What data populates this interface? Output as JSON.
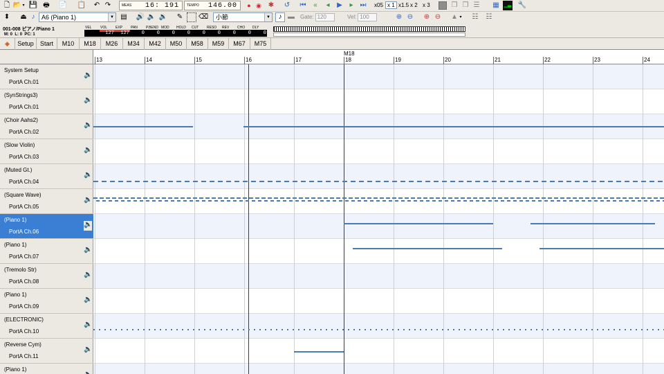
{
  "toolbar": {
    "meas_label": "MEAS",
    "meas_value": "16: 191",
    "tempo_label": "TEMPO",
    "tempo_value": "146.00",
    "speed": [
      "x05",
      "x 1",
      "x1.5",
      "x 2",
      "x 3"
    ]
  },
  "toolbar2": {
    "track_select": "A6 (Piano 1)",
    "unit_select": "小節",
    "gate_label": "Gate:",
    "gate_value": "120",
    "vel_label": "Vel:",
    "vel_value": "100"
  },
  "track_info": {
    "name": "001-008 ピアノ/Piano 1",
    "m_label": "M:",
    "m_value": "0",
    "l_label": "L:",
    "l_value": "0",
    "pc_label": "PC:",
    "pc_value": "1",
    "controls": [
      {
        "label": "VEL",
        "value": ""
      },
      {
        "label": "VOL",
        "value": "127"
      },
      {
        "label": "EXP",
        "value": "127"
      },
      {
        "label": "PAN",
        "value": "0"
      },
      {
        "label": "P.BEND",
        "value": "0"
      },
      {
        "label": "MOD",
        "value": "0"
      },
      {
        "label": "HOLD",
        "value": "0"
      },
      {
        "label": "CUT",
        "value": "0"
      },
      {
        "label": "RESO",
        "value": "0"
      },
      {
        "label": "REV",
        "value": "0"
      },
      {
        "label": "CHO",
        "value": "0"
      },
      {
        "label": "DLY",
        "value": "0"
      }
    ]
  },
  "markers": [
    "Setup",
    "Start",
    "M10",
    "M18",
    "M26",
    "M34",
    "M42",
    "M50",
    "M58",
    "M59",
    "M67",
    "M75"
  ],
  "ruler": {
    "measures": [
      "13",
      "14",
      "15",
      "16",
      "17",
      "18",
      "19",
      "20",
      "21",
      "22",
      "23",
      "24"
    ],
    "marker_label": "M18"
  },
  "tracks": [
    {
      "name": "System Setup",
      "port": "PortA  Ch.01",
      "selected": false
    },
    {
      "name": "(SynStrings3)",
      "port": "PortA  Ch.01",
      "selected": false
    },
    {
      "name": "(Choir Aahs2)",
      "port": "PortA  Ch.02",
      "selected": false
    },
    {
      "name": "(Slow Violin)",
      "port": "PortA  Ch.03",
      "selected": false
    },
    {
      "name": "(Muted Gt.)",
      "port": "PortA  Ch.04",
      "selected": false
    },
    {
      "name": "(Square Wave)",
      "port": "PortA  Ch.05",
      "selected": false
    },
    {
      "name": "(Piano 1)",
      "port": "PortA  Ch.06",
      "selected": true
    },
    {
      "name": "(Piano 1)",
      "port": "PortA  Ch.07",
      "selected": false
    },
    {
      "name": "(Tremolo Str)",
      "port": "PortA  Ch.08",
      "selected": false
    },
    {
      "name": "(Piano 1)",
      "port": "PortA  Ch.09",
      "selected": false
    },
    {
      "name": "(ELECTRONIC)",
      "port": "PortA  Ch.10",
      "selected": false
    },
    {
      "name": "(Reverse Cym)",
      "port": "PortA  Ch.11",
      "selected": false
    },
    {
      "name": "(Piano 1)",
      "port": "",
      "selected": false
    }
  ],
  "colors": {
    "selected": "#3b7fd4",
    "note": "#4a7ab5",
    "alt_row": "#eef3fc"
  }
}
